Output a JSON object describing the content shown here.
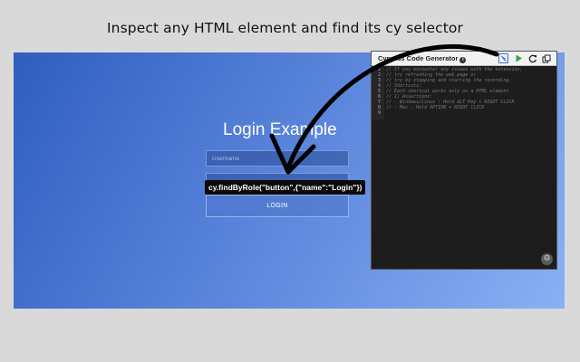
{
  "headline": "Inspect any HTML element and find its cy selector",
  "login": {
    "title": "Login Example",
    "username_placeholder": "Username",
    "password_placeholder": "",
    "button_label": "LOGIN"
  },
  "tooltip": {
    "text": "cy.findByRole(\"button\",{\"name\":\"Login\"})"
  },
  "panel": {
    "title": "Cypress Code Generator",
    "info_icon": "info-icon",
    "toolbar": [
      "inspect-icon",
      "play-icon",
      "refresh-icon",
      "copy-icon"
    ],
    "code_lines": [
      {
        "num": "1",
        "text": "// If you encounter any issues with the extension,"
      },
      {
        "num": "2",
        "text": "// try refreshing the web page or"
      },
      {
        "num": "3",
        "text": "// try by stopping and starting the recording."
      },
      {
        "num": "4",
        "text": "// Shortcuts:"
      },
      {
        "num": "5",
        "text": "// Each shortcut works only on a HTML element"
      },
      {
        "num": "6",
        "text": "// 1) Assertions:"
      },
      {
        "num": "7",
        "text": "//  - Windows/Linux : Hold ALT Key + RIGHT CLICK"
      },
      {
        "num": "8",
        "text": "//  - Mac : Hold OPTION + RIGHT CLICK"
      },
      {
        "num": "9",
        "text": ""
      }
    ],
    "settings_icon": "gear-icon"
  },
  "colors": {
    "page_bg": "#d9d9d9",
    "gradient_start": "#2f5ec0",
    "gradient_end": "#8ab0f4",
    "panel_bg": "#1d1d1d",
    "play_green": "#2fa84f"
  }
}
